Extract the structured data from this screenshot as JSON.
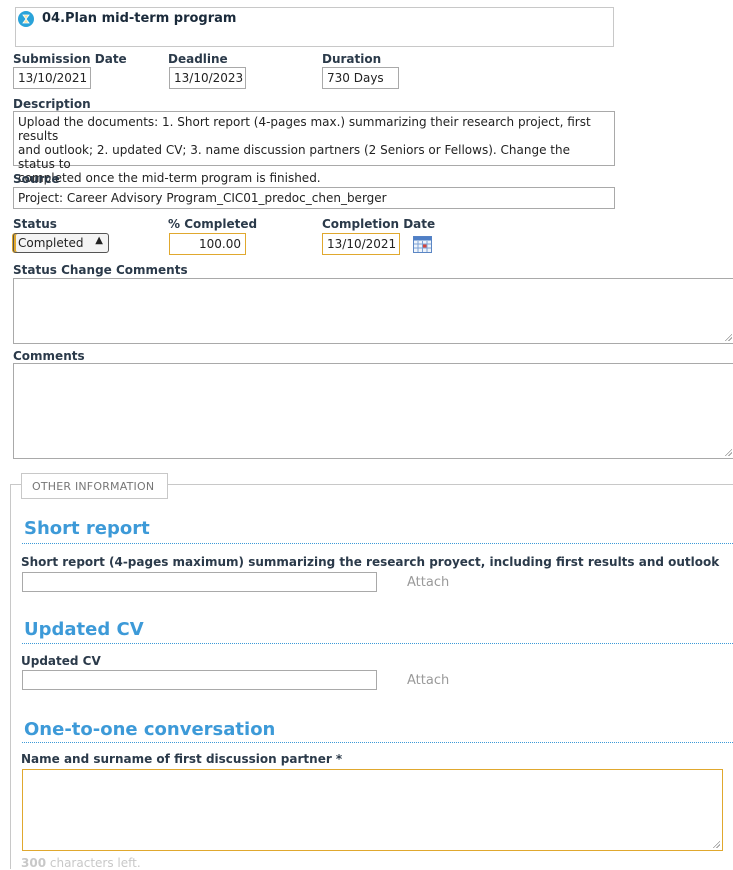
{
  "task": {
    "title": "04.Plan mid-term program"
  },
  "dates": {
    "submission_label": "Submission Date",
    "submission_value": "13/10/2021",
    "deadline_label": "Deadline",
    "deadline_value": "13/10/2023",
    "duration_label": "Duration",
    "duration_value": "730 Days"
  },
  "description": {
    "label": "Description",
    "lines": [
      "Upload the documents: 1. Short report (4-pages max.) summarizing their research project, first results",
      "and outlook; 2. updated CV; 3. name discussion partners (2 Seniors or Fellows). Change the status to",
      "completed once the mid-term program is finished."
    ]
  },
  "source": {
    "label": "Source",
    "value": "Project: Career Advisory Program_CIC01_predoc_chen_berger"
  },
  "status": {
    "label": "Status",
    "value": "Completed",
    "percent_label": "% Completed",
    "percent_value": "100.00",
    "completion_label": "Completion Date",
    "completion_value": "13/10/2021"
  },
  "status_change_comments": {
    "label": "Status Change Comments"
  },
  "comments": {
    "label": "Comments"
  },
  "other_info": {
    "legend": "OTHER INFORMATION"
  },
  "short_report": {
    "title": "Short report",
    "field_label": "Short report (4-pages maximum) summarizing the research proyect, including first results and outlook",
    "attach": "Attach"
  },
  "updated_cv": {
    "title": "Updated CV",
    "field_label": "Updated CV",
    "attach": "Attach"
  },
  "conversation": {
    "title": "One-to-one conversation",
    "field_label": "Name and surname of first discussion partner *",
    "chars_count": "300",
    "chars_text": " characters left."
  },
  "colors": {
    "accent": "#3d9ad8",
    "highlight": "#e0a82e"
  },
  "icons": {
    "title": "hourglass-icon",
    "calendar": "calendar-icon"
  }
}
